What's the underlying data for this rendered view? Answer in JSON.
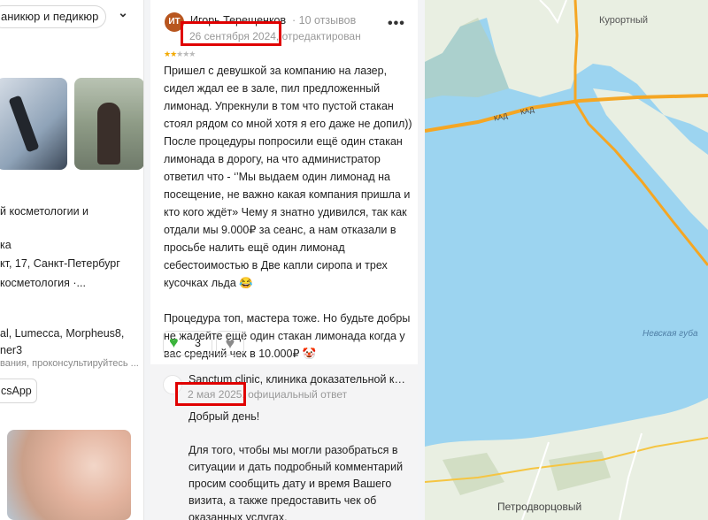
{
  "left_panel": {
    "chip_label": "аникюр и педикюр",
    "line1": "й косметологии и",
    "line2": "ка",
    "line3": "кт, 17, Санкт-Петербург",
    "line4": "косметология ·...",
    "line5": "al, Lumecca, Morpheus8,",
    "line6": "ner3",
    "line7": "вания, проконсультируйтесь ...",
    "apps_button": "csApp"
  },
  "review": {
    "avatar_initials": "ИТ",
    "author": "Игорь Терещенков",
    "reviews_count": "· 10 отзывов",
    "date": "26 сентября 2024",
    "edited": ", отредактирован",
    "rating": 2,
    "paragraphs": [
      "Пришел с девушкой за компанию на лазер, сидел ждал ее в зале, пил предложенный лимонад. Упрекнули в том что пустой стакан стоял рядом со мной хотя я его даже не допил))",
      "После процедуры попросили ещё один стакан лимонада в дорогу, на что администратор ответил что - ‘’Мы выдаем один лимонад на посещение, не важно какая компания пришла и кто кого ждёт» Чему я знатно удивился, так как отдали мы 9.000₽ за сеанс, а нам отказали в просьбе налить ещё один лимонад себестоимостью в Две капли сиропа и трех кусочках льда 😂",
      "",
      "Процедура топ, мастера тоже. Но будьте добры не жалейте ещё один стакан лимонада когда у вас средний чек в 10.000₽ 🤡"
    ],
    "likes": "3"
  },
  "reply": {
    "author": "Sanctum clinic, клиника доказательной косметологии",
    "date": "2 мая 2025",
    "official": ", официальный ответ",
    "paragraphs": [
      "Добрый день!",
      "",
      "Для того, чтобы мы могли разобраться в ситуации и дать подробный комментарий просим сообщить дату и время Вашего визита, а также предоставить чек об оказанных услугах."
    ]
  },
  "map": {
    "label_kurortny": "Курортный",
    "label_kad1": "КАД",
    "label_kad2": "КАД",
    "label_bay": "Невская губа",
    "label_petrodvortsovy": "Петродворцовый"
  },
  "colors": {
    "highlight": "#e00000",
    "water": "#9cd4f0",
    "land": "#e9efe2",
    "road": "#f5a623",
    "star": "#f2a900",
    "like": "#3bb43b"
  }
}
